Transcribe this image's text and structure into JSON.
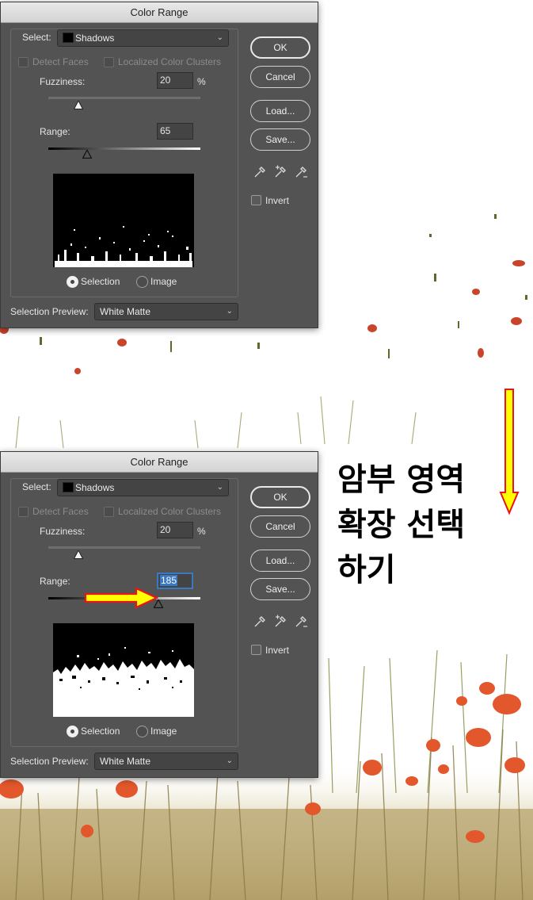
{
  "dialogs": [
    {
      "id": "before",
      "title": "Color Range",
      "select_label": "Select:",
      "select_value": "Shadows",
      "detect_faces_label": "Detect Faces",
      "localized_clusters_label": "Localized Color Clusters",
      "fuzziness_label": "Fuzziness:",
      "fuzziness_value": "20",
      "fuzziness_unit": "%",
      "fuzziness_level": 0.2,
      "range_label": "Range:",
      "range_value": "65",
      "range_level": 0.255,
      "range_focused": false,
      "radio_selection_label": "Selection",
      "radio_image_label": "Image",
      "preview_label": "Selection Preview:",
      "preview_value": "White Matte",
      "ok_label": "OK",
      "cancel_label": "Cancel",
      "load_label": "Load...",
      "save_label": "Save...",
      "invert_label": "Invert"
    },
    {
      "id": "after",
      "title": "Color Range",
      "select_label": "Select:",
      "select_value": "Shadows",
      "detect_faces_label": "Detect Faces",
      "localized_clusters_label": "Localized Color Clusters",
      "fuzziness_label": "Fuzziness:",
      "fuzziness_value": "20",
      "fuzziness_unit": "%",
      "fuzziness_level": 0.2,
      "range_label": "Range:",
      "range_value": "185",
      "range_level": 0.725,
      "range_focused": true,
      "radio_selection_label": "Selection",
      "radio_image_label": "Image",
      "preview_label": "Selection Preview:",
      "preview_value": "White Matte",
      "ok_label": "OK",
      "cancel_label": "Cancel",
      "load_label": "Load...",
      "save_label": "Save...",
      "invert_label": "Invert"
    }
  ],
  "annotation": {
    "text": "암부 영역\n확장 선택\n하기",
    "arrow_fill": "#ffff00",
    "arrow_stroke": "#e8141a"
  },
  "colors": {
    "dialog_bg": "#535353",
    "accent_focus": "#3b78c4",
    "poppy": "#e2572b",
    "grass": "#b9a874"
  },
  "icons": {
    "eyedropper": "eyedropper-icon",
    "eyedropper_add": "eyedropper-plus-icon",
    "eyedropper_subtract": "eyedropper-minus-icon"
  }
}
